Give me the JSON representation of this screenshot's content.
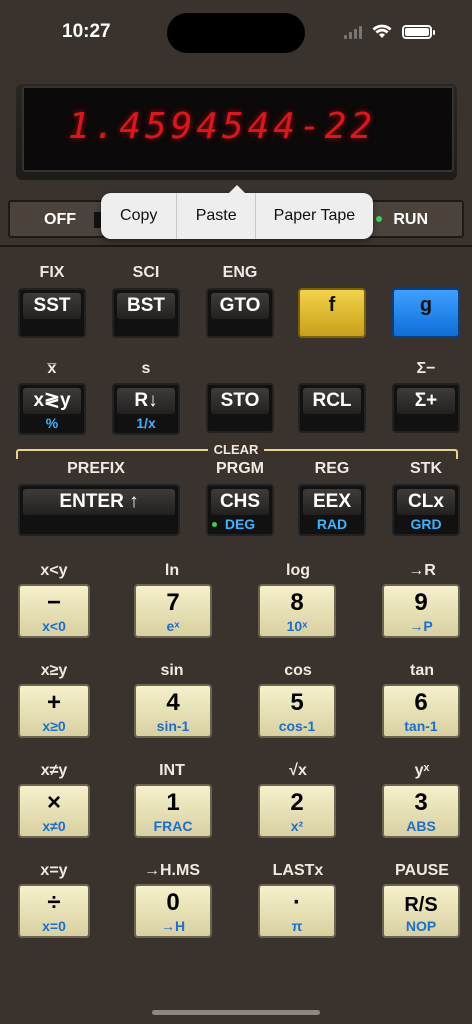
{
  "status": {
    "time": "10:27"
  },
  "display": {
    "value": "1.4594544-22"
  },
  "switch": {
    "off": "OFF",
    "run": "RUN"
  },
  "menu": {
    "items": [
      "Copy",
      "Paste",
      "Paper Tape"
    ]
  },
  "clear_label": "CLEAR",
  "row1": {
    "labels": [
      "FIX",
      "SCI",
      "ENG",
      "",
      ""
    ],
    "keys": [
      "SST",
      "BST",
      "GTO",
      "f",
      "g"
    ]
  },
  "row2": {
    "labels": [
      "x̅",
      "s",
      "",
      "",
      "Σ−"
    ],
    "keys": [
      "x≷y",
      "R↓",
      "STO",
      "RCL",
      "Σ+"
    ],
    "subs": [
      "%",
      "1/x",
      "",
      "",
      ""
    ]
  },
  "row3": {
    "labels": [
      "PREFIX",
      "PRGM",
      "REG",
      "STK"
    ],
    "keys": [
      "ENTER ↑",
      "CHS",
      "EEX",
      "CLx"
    ],
    "subs": [
      "",
      "DEG",
      "RAD",
      "GRD"
    ]
  },
  "row4": {
    "labels": [
      "x<y",
      "ln",
      "log",
      "→R"
    ],
    "keys": [
      "−",
      "7",
      "8",
      "9"
    ],
    "subs": [
      "x<0",
      "eˣ",
      "10ˣ",
      "→P"
    ]
  },
  "row5": {
    "labels": [
      "x≥y",
      "sin",
      "cos",
      "tan"
    ],
    "keys": [
      "+",
      "4",
      "5",
      "6"
    ],
    "subs": [
      "x≥0",
      "sin-1",
      "cos-1",
      "tan-1"
    ]
  },
  "row6": {
    "labels": [
      "x≠y",
      "INT",
      "√x",
      "yˣ"
    ],
    "keys": [
      "×",
      "1",
      "2",
      "3"
    ],
    "subs": [
      "x≠0",
      "FRAC",
      "x²",
      "ABS"
    ]
  },
  "row7": {
    "labels": [
      "x=y",
      "→H.MS",
      "LASTx",
      "PAUSE"
    ],
    "keys": [
      "÷",
      "0",
      "·",
      "R/S"
    ],
    "subs": [
      "x=0",
      "→H",
      "π",
      "NOP"
    ]
  }
}
